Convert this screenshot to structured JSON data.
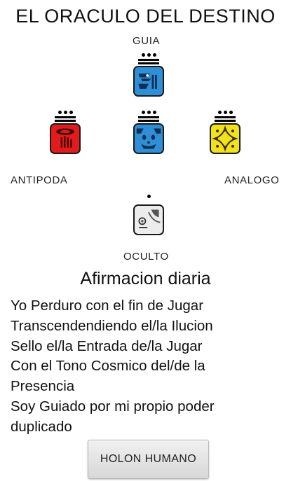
{
  "app": {
    "title": "EL ORACULO DEL DESTINO"
  },
  "oracle": {
    "guide": {
      "label": "GUIA",
      "tone": 13,
      "color": "#2f8fd6",
      "icon": "blue-glyph-icon"
    },
    "antipode": {
      "label": "ANTIPODA",
      "tone": 13,
      "color": "#e21b1b",
      "icon": "red-glyph-icon"
    },
    "destiny": {
      "tone": 13,
      "color": "#2f8fd6",
      "icon": "blue-monkey-glyph-icon"
    },
    "analog": {
      "label": "ANALOGO",
      "tone": 13,
      "color": "#f3e21a",
      "icon": "yellow-star-glyph-icon"
    },
    "occult": {
      "label": "OCULTO",
      "tone": 1,
      "color": "#ececec",
      "icon": "white-glyph-icon"
    }
  },
  "affirmation": {
    "heading": "Afirmacion diaria",
    "lines": [
      "Yo Perduro con el fin de Jugar",
      "Transcendendiendo el/la Ilucion",
      "Sello el/la Entrada de/la Jugar",
      "Con el Tono Cosmico del/de la",
      "Presencia",
      "Soy Guiado por mi propio poder",
      "duplicado"
    ]
  },
  "button": {
    "label": "HOLON HUMANO"
  }
}
